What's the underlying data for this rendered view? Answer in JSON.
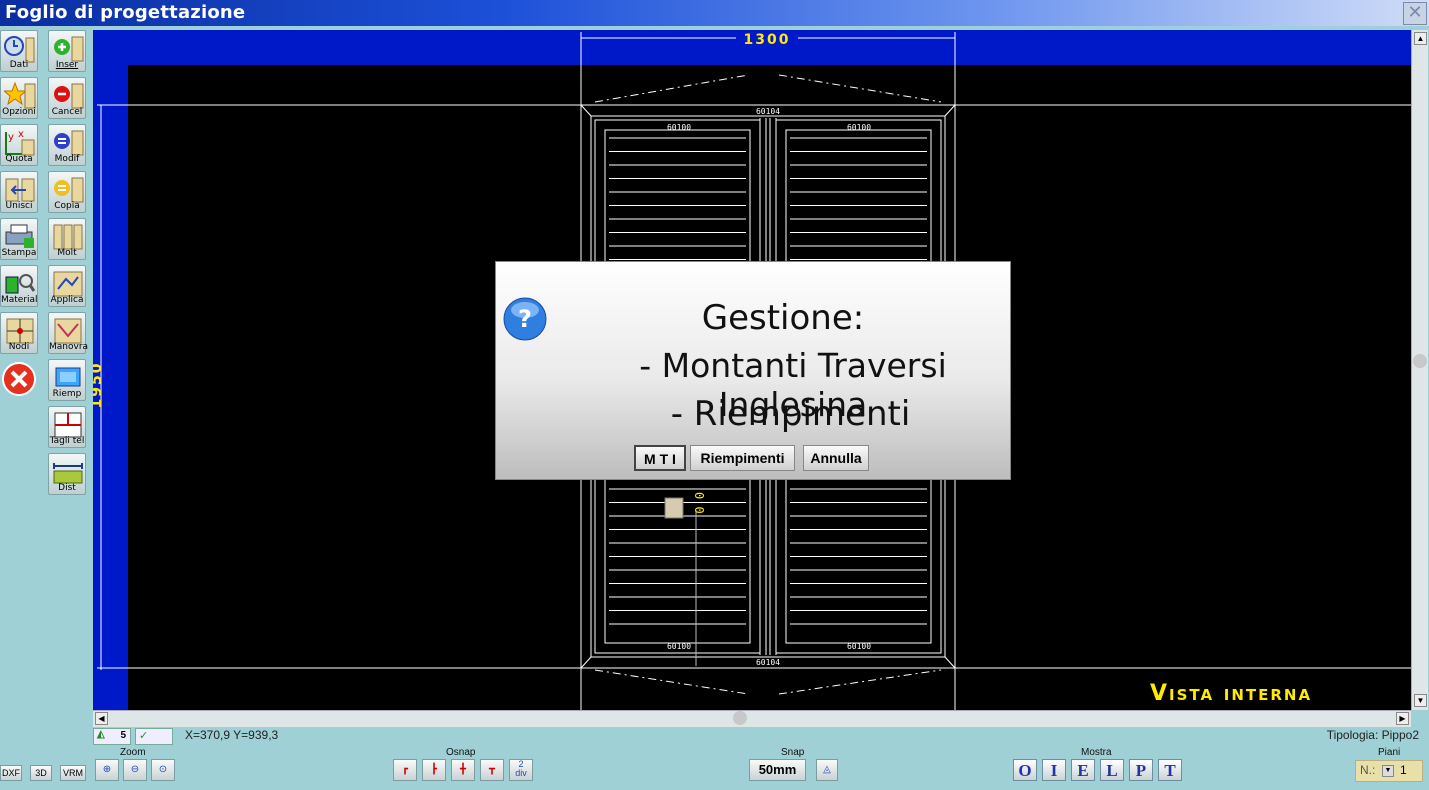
{
  "window": {
    "title": "Foglio di progettazione",
    "close_glyph": "✕"
  },
  "toolbar_left": [
    {
      "label": "Dati",
      "icon": "clock-icon"
    },
    {
      "label": "Inser",
      "icon": "add-window-icon"
    },
    {
      "label": "Opzioni",
      "icon": "star-icon"
    },
    {
      "label": "Cancel",
      "icon": "delete-window-icon"
    },
    {
      "label": "Quota",
      "icon": "dimension-icon"
    },
    {
      "label": "Modif",
      "icon": "edit-window-icon"
    },
    {
      "label": "Unisci",
      "icon": "merge-icon"
    },
    {
      "label": "Copia",
      "icon": "copy-window-icon"
    },
    {
      "label": "Stampa",
      "icon": "printer-icon"
    },
    {
      "label": "Molt",
      "icon": "multiply-icon"
    },
    {
      "label": "Material",
      "icon": "material-icon"
    },
    {
      "label": "Applica",
      "icon": "apply-icon"
    },
    {
      "label": "Nodi",
      "icon": "nodes-icon"
    },
    {
      "label": "Manovra",
      "icon": "maneuver-icon"
    },
    {
      "label": "",
      "icon": "close-red-icon"
    },
    {
      "label": "Riemp",
      "icon": "fill-icon"
    },
    {
      "label": "Tagli tel",
      "icon": "frame-cuts-icon"
    },
    {
      "label": "Dist",
      "icon": "distance-icon"
    }
  ],
  "drawing": {
    "width_dim": "1300",
    "height_dim": "1950",
    "profile_top": "60104",
    "profile_bottom": "60104",
    "sash_top_left": "60100",
    "sash_top_right": "60100",
    "sash_bottom_left": "60100",
    "sash_bottom_right": "60100",
    "small_mark": "0 0",
    "view_label": "Vista interna"
  },
  "dialog": {
    "line1": "Gestione:",
    "line2": "- Montanti Traversi Inglesina",
    "line3": "- Riempimenti",
    "btn_mti": "M T I",
    "btn_riempimenti": "Riempimenti",
    "btn_annulla": "Annulla"
  },
  "status": {
    "layer_number": "5",
    "coords": "X=370,9  Y=939,3",
    "tipologia": "Tipologia: Pippo2"
  },
  "bottom": {
    "dxf": "DXF",
    "three_d": "3D",
    "vrm": "VRM",
    "zoom_label": "Zoom",
    "osnap_label": "Osnap",
    "snap_label": "Snap",
    "snap_value": "50mm",
    "mostra_label": "Mostra",
    "mostra_buttons": [
      "O",
      "I",
      "E",
      "L",
      "P",
      "T"
    ],
    "piani_label": "Piani",
    "piani_prefix": "N.:",
    "piani_value": "1",
    "osnap_div": "2\ndiv"
  },
  "colors": {
    "canvas_bg": "#000000",
    "border_blue": "#0019c8",
    "accent_yellow": "#ffea00",
    "panel_bg": "#9fd0d5"
  }
}
